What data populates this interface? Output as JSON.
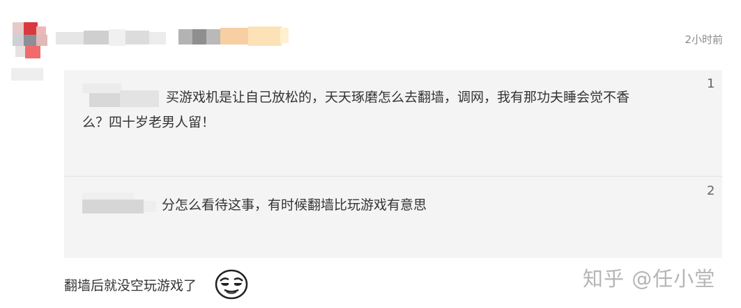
{
  "post": {
    "time": "2小时前"
  },
  "replies": [
    {
      "index": "1",
      "text_line1": "买游戏机是让自己放松的，天天琢磨怎么去翻墙，调网，我有那功夫睡会觉不香",
      "text_line2": "么？四十岁老男人留！"
    },
    {
      "index": "2",
      "text_line1": "分怎么看待这事，有时候翻墙比玩游戏有意思"
    }
  ],
  "caption": {
    "text": "翻墙后就没空玩游戏了",
    "emoji_icon": "smirk-face-icon"
  },
  "watermark": {
    "text": "知乎 @任小堂"
  }
}
